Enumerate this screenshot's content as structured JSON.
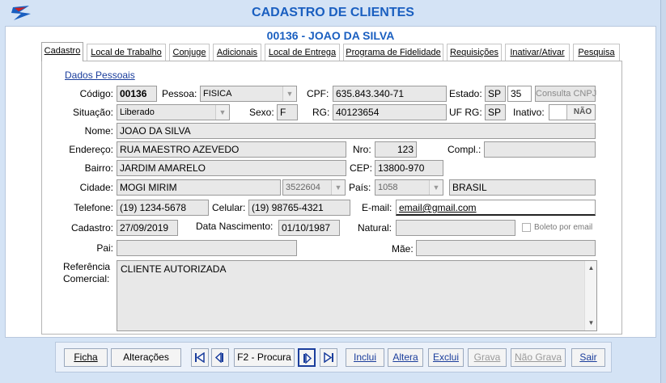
{
  "window": {
    "title": "CADASTRO DE CLIENTES"
  },
  "client_header": "00136 - JOAO DA SILVA",
  "tabs": [
    {
      "label": "Cadastro",
      "active": true
    },
    {
      "label": "Local de Trabalho"
    },
    {
      "label": "Conjuge"
    },
    {
      "label": "Adicionais"
    },
    {
      "label": "Local de Entrega"
    },
    {
      "label": "Programa de Fidelidade"
    },
    {
      "label": "Requisições"
    },
    {
      "label": "Inativar/Ativar"
    },
    {
      "label": "Pesquisa"
    }
  ],
  "section_title": "Dados Pessoais",
  "labels": {
    "codigo": "Código:",
    "pessoa": "Pessoa:",
    "cpf": "CPF:",
    "estado": "Estado:",
    "situacao": "Situação:",
    "sexo": "Sexo:",
    "rg": "RG:",
    "uf_rg": "UF RG:",
    "inativo": "Inativo:",
    "nome": "Nome:",
    "endereco": "Endereço:",
    "nro": "Nro:",
    "compl": "Compl.:",
    "bairro": "Bairro:",
    "cep": "CEP:",
    "cidade": "Cidade:",
    "pais": "País:",
    "telefone": "Telefone:",
    "celular": "Celular:",
    "email": "E-mail:",
    "cadastro": "Cadastro:",
    "data_nascimento": "Data Nascimento:",
    "natural": "Natural:",
    "boleto": "Boleto por email",
    "pai": "Pai:",
    "mae": "Mãe:",
    "referencia_1": "Referência",
    "referencia_2": "Comercial:"
  },
  "fields": {
    "codigo": "00136",
    "pessoa": "FISICA",
    "cpf": "635.843.340-71",
    "estado": "SP",
    "estado_code": "35",
    "consulta_cnpj": "Consulta CNPJ",
    "situacao": "Liberado",
    "sexo": "F",
    "rg": "40123654",
    "uf_rg": "SP",
    "inativo": "NÃO",
    "nome": "JOAO DA SILVA",
    "endereco": "RUA MAESTRO AZEVEDO",
    "nro": "123",
    "compl": "",
    "bairro": "JARDIM AMARELO",
    "cep": "13800-970",
    "cidade": "MOGI MIRIM",
    "cidade_code": "3522604",
    "pais_code": "1058",
    "pais": "BRASIL",
    "telefone": "(19) 1234-5678",
    "celular": "(19) 98765-4321",
    "email": "email@gmail.com",
    "cadastro": "27/09/2019",
    "data_nascimento": "01/10/1987",
    "natural": "",
    "pai": "",
    "mae": "",
    "referencia_comercial": "CLIENTE AUTORIZADA"
  },
  "toolbar": {
    "ficha": "Ficha",
    "alteracoes": "Alterações",
    "procura": "F2 - Procura",
    "inclui": "Inclui",
    "altera": "Altera",
    "exclui": "Exclui",
    "grava": "Grava",
    "nao_grava": "Não Grava",
    "sair": "Sair"
  },
  "colors": {
    "accent": "#1a5fc0",
    "link": "#1a3d9c",
    "background": "#d4e3f5"
  }
}
